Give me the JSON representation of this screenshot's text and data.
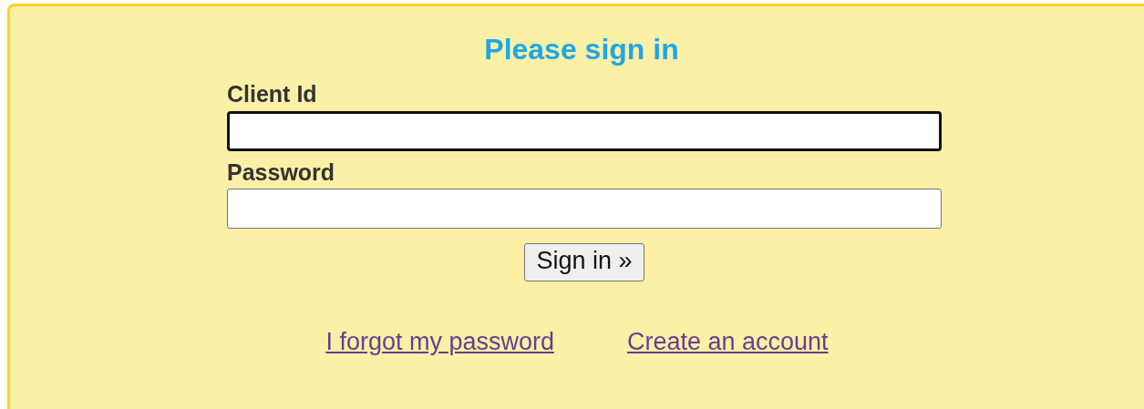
{
  "title": "Please sign in",
  "fields": [
    {
      "label": "Client Id",
      "focused": true
    },
    {
      "label": "Password",
      "focused": false
    }
  ],
  "button": "Sign in »",
  "links": [
    {
      "label": "I forgot my password"
    },
    {
      "label": "Create an account"
    }
  ]
}
